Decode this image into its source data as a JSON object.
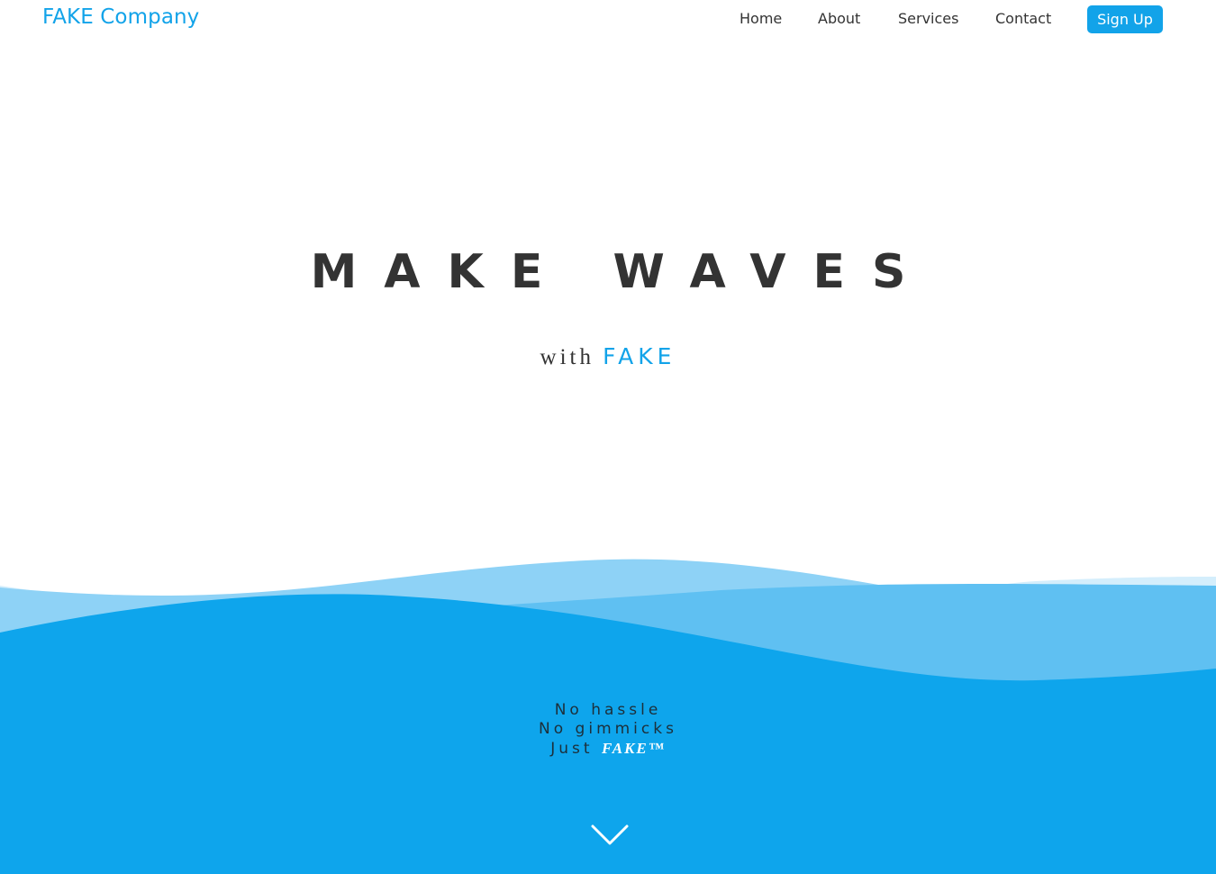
{
  "nav": {
    "brand": "FAKE Company",
    "links": [
      "Home",
      "About",
      "Services",
      "Contact"
    ],
    "signup": "Sign Up"
  },
  "hero": {
    "title": "MAKE WAVES",
    "with": "with",
    "brand": "FAKE"
  },
  "tagline": {
    "line1": "No hassle",
    "line2": "No gimmicks",
    "line3_prefix": "Just",
    "line3_brand": "FAKE™"
  },
  "icons": {
    "scroll": "chevron-down-icon"
  },
  "colors": {
    "accent": "#12a3e9",
    "text": "#333333",
    "wave_dark": "#0ea5ec",
    "wave_mid": "#5bbdf1",
    "wave_light": "#8ed2f6",
    "wave_pale": "#c5e8fb"
  }
}
